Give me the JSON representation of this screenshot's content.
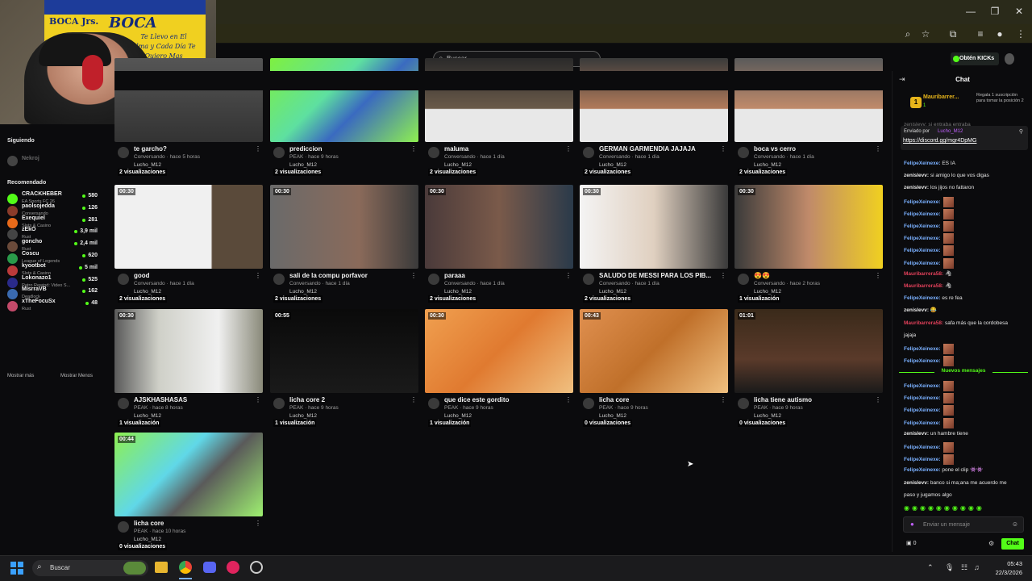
{
  "search": {
    "placeholder": "Buscar"
  },
  "header": {
    "get_kicks_label": "Obtén KICKs"
  },
  "webcam": {
    "flag_text_1": "BOCA Jrs.",
    "flag_text_2": "BOCA",
    "flag_text_3": "Te Llevo en El Alma y Cada Día Te Quiero Mas"
  },
  "sidebar": {
    "following_title": "Siguiendo",
    "following_user": "Nekroj",
    "recommended_title": "Recomendado",
    "show_more": "Mostrar más",
    "show_less": "Mostrar Menos",
    "items": [
      {
        "name": "CRACKHEBER",
        "category": "EA Sports FC 26",
        "viewers": "580"
      },
      {
        "name": "paolsojedda",
        "category": "Conversando",
        "viewers": "126"
      },
      {
        "name": "Exequiel",
        "category": "Slots & Casino",
        "viewers": "281"
      },
      {
        "name": "zEkO",
        "category": "Rust",
        "viewers": "3,9 mil"
      },
      {
        "name": "goncho",
        "category": "Rust",
        "viewers": "2,4 mil"
      },
      {
        "name": "Coscu",
        "category": "League of Legends",
        "viewers": "620"
      },
      {
        "name": "kyootbot",
        "category": "Slots & Casino",
        "viewers": "5 mil"
      },
      {
        "name": "Lokonazo1",
        "category": "Retro Rewind: Video S...",
        "viewers": "525"
      },
      {
        "name": "MisrraVB",
        "category": "Deadlock",
        "viewers": "162"
      },
      {
        "name": "xTheFocuSx",
        "category": "Rust",
        "viewers": "48"
      }
    ]
  },
  "clips": [
    {
      "title": "te garcho?",
      "sub": "Conversando · hace 5 horas",
      "author": "Lucho_M12",
      "views": "2 visualizaciones",
      "duration": ""
    },
    {
      "title": "prediccion",
      "sub": "PEAK · hace 9 horas",
      "author": "Lucho_M12",
      "views": "2 visualizaciones",
      "duration": ""
    },
    {
      "title": "maluma",
      "sub": "Conversando · hace 1 día",
      "author": "Lucho_M12",
      "views": "2 visualizaciones",
      "duration": ""
    },
    {
      "title": "GERMAN GARMENDIA JAJAJA",
      "sub": "Conversando · hace 1 día",
      "author": "Lucho_M12",
      "views": "2 visualizaciones",
      "duration": ""
    },
    {
      "title": "boca vs cerro",
      "sub": "Conversando · hace 1 día",
      "author": "Lucho_M12",
      "views": "2 visualizaciones",
      "duration": ""
    },
    {
      "title": "good",
      "sub": "Conversando · hace 1 día",
      "author": "Lucho_M12",
      "views": "2 visualizaciones",
      "duration": "00:30"
    },
    {
      "title": "sali de la compu porfavor",
      "sub": "Conversando · hace 1 día",
      "author": "Lucho_M12",
      "views": "2 visualizaciones",
      "duration": "00:30"
    },
    {
      "title": "paraaa",
      "sub": "Conversando · hace 1 día",
      "author": "Lucho_M12",
      "views": "2 visualizaciones",
      "duration": "00:30"
    },
    {
      "title": "SALUDO DE MESSI PARA LOS PIB...",
      "sub": "Conversando · hace 1 día",
      "author": "Lucho_M12",
      "views": "2 visualizaciones",
      "duration": "00:30"
    },
    {
      "title": "😍😍",
      "sub": "Conversando · hace 2 horas",
      "author": "Lucho_M12",
      "views": "1 visualización",
      "duration": "00:30"
    },
    {
      "title": "AJSKHASHASAS",
      "sub": "PEAK · hace 8 horas",
      "author": "Lucho_M12",
      "views": "1 visualización",
      "duration": "00:30"
    },
    {
      "title": "licha core 2",
      "sub": "PEAK · hace 9 horas",
      "author": "Lucho_M12",
      "views": "1 visualización",
      "duration": "00:55"
    },
    {
      "title": "que dice este gordito",
      "sub": "PEAK · hace 9 horas",
      "author": "Lucho_M12",
      "views": "1 visualización",
      "duration": "00:30"
    },
    {
      "title": "licha core",
      "sub": "PEAK · hace 9 horas",
      "author": "Lucho_M12",
      "views": "0 visualizaciones",
      "duration": "00:43"
    },
    {
      "title": "licha tiene autismo",
      "sub": "PEAK · hace 9 horas",
      "author": "Lucho_M12",
      "views": "0 visualizaciones",
      "duration": "01:01"
    },
    {
      "title": "licha core",
      "sub": "PEAK · hace 10 horas",
      "author": "Lucho_M12",
      "views": "0 visualizaciones",
      "duration": "00:44"
    }
  ],
  "chat": {
    "title": "Chat",
    "gift_user": "Mauribarrer...",
    "gift_count": "1",
    "gift_text": "Regala 1 suscripción para tomar la posición 2",
    "partial_line": "zenislevv: si entraba entraba",
    "pinned_label": "Enviado por",
    "pinned_user": "Lucho_M12",
    "pinned_link": "https://discord.gg/mgr4DpMG",
    "new_messages": "Nuevos mensajes",
    "input_placeholder": "Enviar un mensaje",
    "kicks_count": "0",
    "send_label": "Chat",
    "messages": [
      {
        "user": "FelipeXeinexe:",
        "text": "ES IA",
        "color": "#e8e8e8",
        "emote": false
      },
      {
        "user": "zenislevv:",
        "text": "si amigo lo que vos digas",
        "color": "#e8e8e8",
        "emote": false
      },
      {
        "user": "zenislevv:",
        "text": "los jijos no fattaron",
        "color": "#e8e8e8",
        "emote": false
      },
      {
        "user": "FelipeXeinexe:",
        "text": "",
        "color": "#e8e8e8",
        "emote": true
      },
      {
        "user": "FelipeXeinexe:",
        "text": "",
        "color": "#e8e8e8",
        "emote": true
      },
      {
        "user": "FelipeXeinexe:",
        "text": "",
        "color": "#e8e8e8",
        "emote": true
      },
      {
        "user": "FelipeXeinexe:",
        "text": "",
        "color": "#e8e8e8",
        "emote": true
      },
      {
        "user": "FelipeXeinexe:",
        "text": "",
        "color": "#e8e8e8",
        "emote": true
      },
      {
        "user": "FelipeXeinexe:",
        "text": "",
        "color": "#e8e8e8",
        "emote": true
      },
      {
        "user": "Mauribarrera58:",
        "text": "🦓",
        "color": "#e0405a",
        "emote": false
      },
      {
        "user": "Mauribarrera58:",
        "text": "🦓",
        "color": "#e0405a",
        "emote": false
      },
      {
        "user": "FelipeXeinexe:",
        "text": "es re fea",
        "color": "#e8e8e8",
        "emote": false
      },
      {
        "user": "zenislevv:",
        "text": "😂",
        "color": "#e8e8e8",
        "emote": false
      },
      {
        "user": "Mauribarrera58:",
        "text": "safa más que la cordobesa",
        "color": "#e0405a",
        "emote": false
      },
      {
        "user": "",
        "text": "jajaja",
        "color": "#e8e8e8",
        "emote": false
      },
      {
        "user": "FelipeXeinexe:",
        "text": "",
        "color": "#e8e8e8",
        "emote": true
      },
      {
        "user": "FelipeXeinexe:",
        "text": "",
        "color": "#e8e8e8",
        "emote": true
      }
    ],
    "messages2": [
      {
        "user": "FelipeXeinexe:",
        "text": "",
        "emote": true
      },
      {
        "user": "FelipeXeinexe:",
        "text": "",
        "emote": true
      },
      {
        "user": "FelipeXeinexe:",
        "text": "",
        "emote": true
      },
      {
        "user": "FelipeXeinexe:",
        "text": "",
        "emote": true
      },
      {
        "user": "zenislevv:",
        "text": "un hambre tiene",
        "emote": false
      },
      {
        "user": "FelipeXeinexe:",
        "text": "",
        "emote": true
      },
      {
        "user": "FelipeXeinexe:",
        "text": "",
        "emote": true
      },
      {
        "user": "FelipeXeinexe:",
        "text": "pone el clip 👾👾",
        "emote": false
      },
      {
        "user": "zenislevv:",
        "text": "banco si ma;ana me acuerdo me",
        "emote": false
      },
      {
        "user": "",
        "text": "paso y jugamos algo",
        "emote": false
      }
    ]
  },
  "taskbar": {
    "search_placeholder": "Buscar",
    "time": "05:43",
    "date": "22/3/2026"
  },
  "colors": {
    "accent": "#53fc18",
    "background": "#0b0b0d",
    "chat_red": "#e0405a"
  }
}
